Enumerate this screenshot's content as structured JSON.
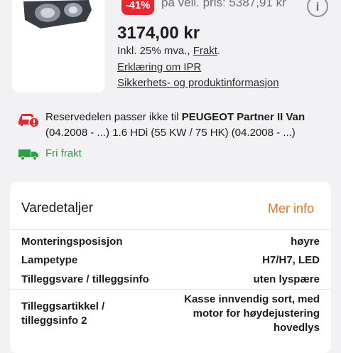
{
  "product": {
    "discount_badge": "-41%",
    "old_price": "på veil. pris: 5387,91 kr",
    "price": "3174,00 kr",
    "vat_text": "Inkl. 25% mva.,",
    "shipping_link": "Frakt",
    "vat_suffix": ".",
    "ipr_link": "Erklæring om IPR",
    "safety_link": "Sikkerhets- og produktinformasjon",
    "info_icon": "i"
  },
  "compat": {
    "text_prefix": "Reservedelen passer ikke til ",
    "vehicle": "PEUGEOT Partner II Van",
    "detail": "(04.2008 - ...) 1.6 HDi (55 KW / 75 HK) (04.2008 - ...)",
    "icon": "car-warning-icon",
    "icon_color": "#e8262f"
  },
  "shipping": {
    "label": "Fri frakt",
    "icon": "truck-icon",
    "color": "#2e9e43"
  },
  "details": {
    "title": "Varedetaljer",
    "more_link": "Mer info",
    "accent": "#e8731e",
    "rows": [
      {
        "key": "Monteringsposisjon",
        "value": "høyre"
      },
      {
        "key": "Lampetype",
        "value": "H7/H7, LED"
      },
      {
        "key": "Tilleggsvare / tilleggsinfo",
        "value": "uten lyspære"
      },
      {
        "key_line1": "Tilleggsartikkel /",
        "key_line2": "tilleggsinfo 2",
        "value_line1": "Kasse innvendig sort, med",
        "value_line2": "motor for høydejustering",
        "value_line3": "hovedlys"
      }
    ]
  }
}
